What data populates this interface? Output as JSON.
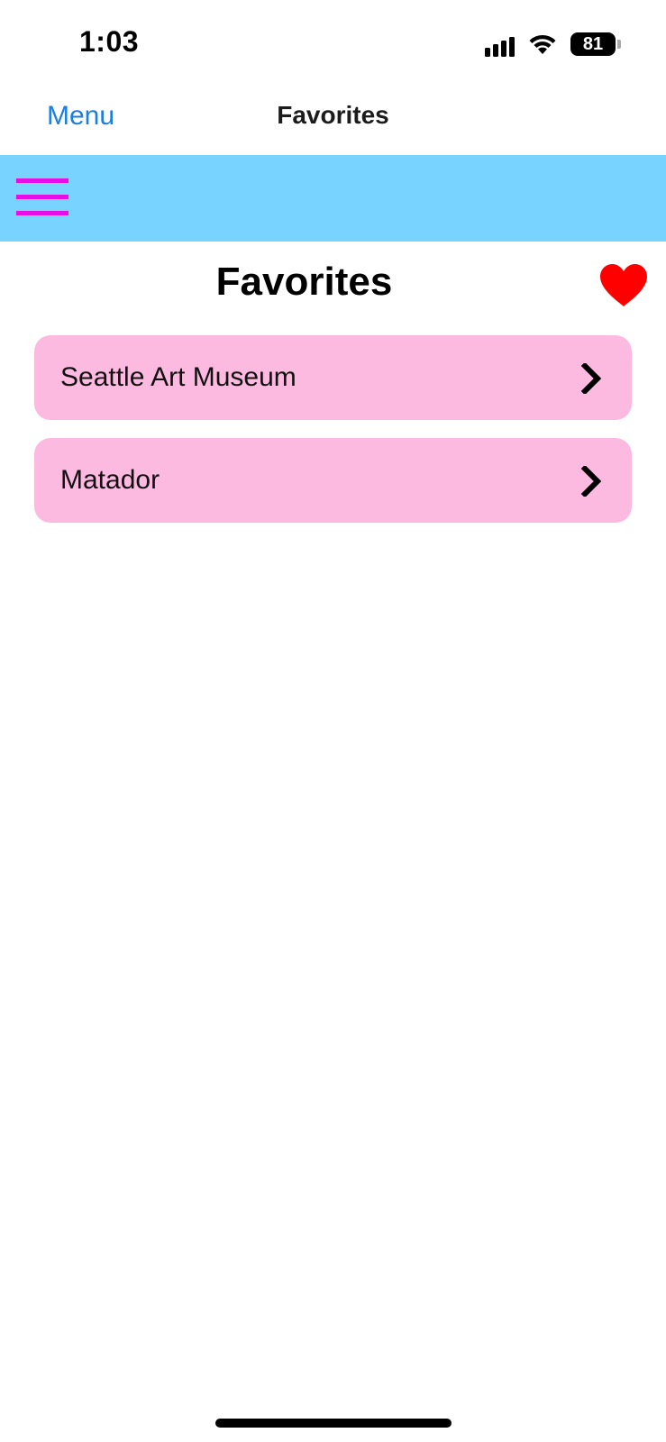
{
  "status_bar": {
    "time": "1:03",
    "battery_level": "81",
    "signal_bars_active": 4,
    "icons": [
      "signal-icon",
      "wifi-icon",
      "battery-icon"
    ]
  },
  "nav": {
    "back_label": "Menu",
    "title": "Favorites"
  },
  "header": {
    "background_color": "#78d4ff",
    "menu_icon": "hamburger-icon",
    "menu_icon_color": "#e60de6"
  },
  "page": {
    "title": "Favorites",
    "favorite_icon": "heart-icon",
    "favorite_icon_color": "#ff0000"
  },
  "favorites": {
    "item_background": "#fdbae0",
    "items": [
      {
        "label": "Seattle Art Museum",
        "icon": "chevron-right-icon"
      },
      {
        "label": "Matador",
        "icon": "chevron-right-icon"
      }
    ]
  }
}
